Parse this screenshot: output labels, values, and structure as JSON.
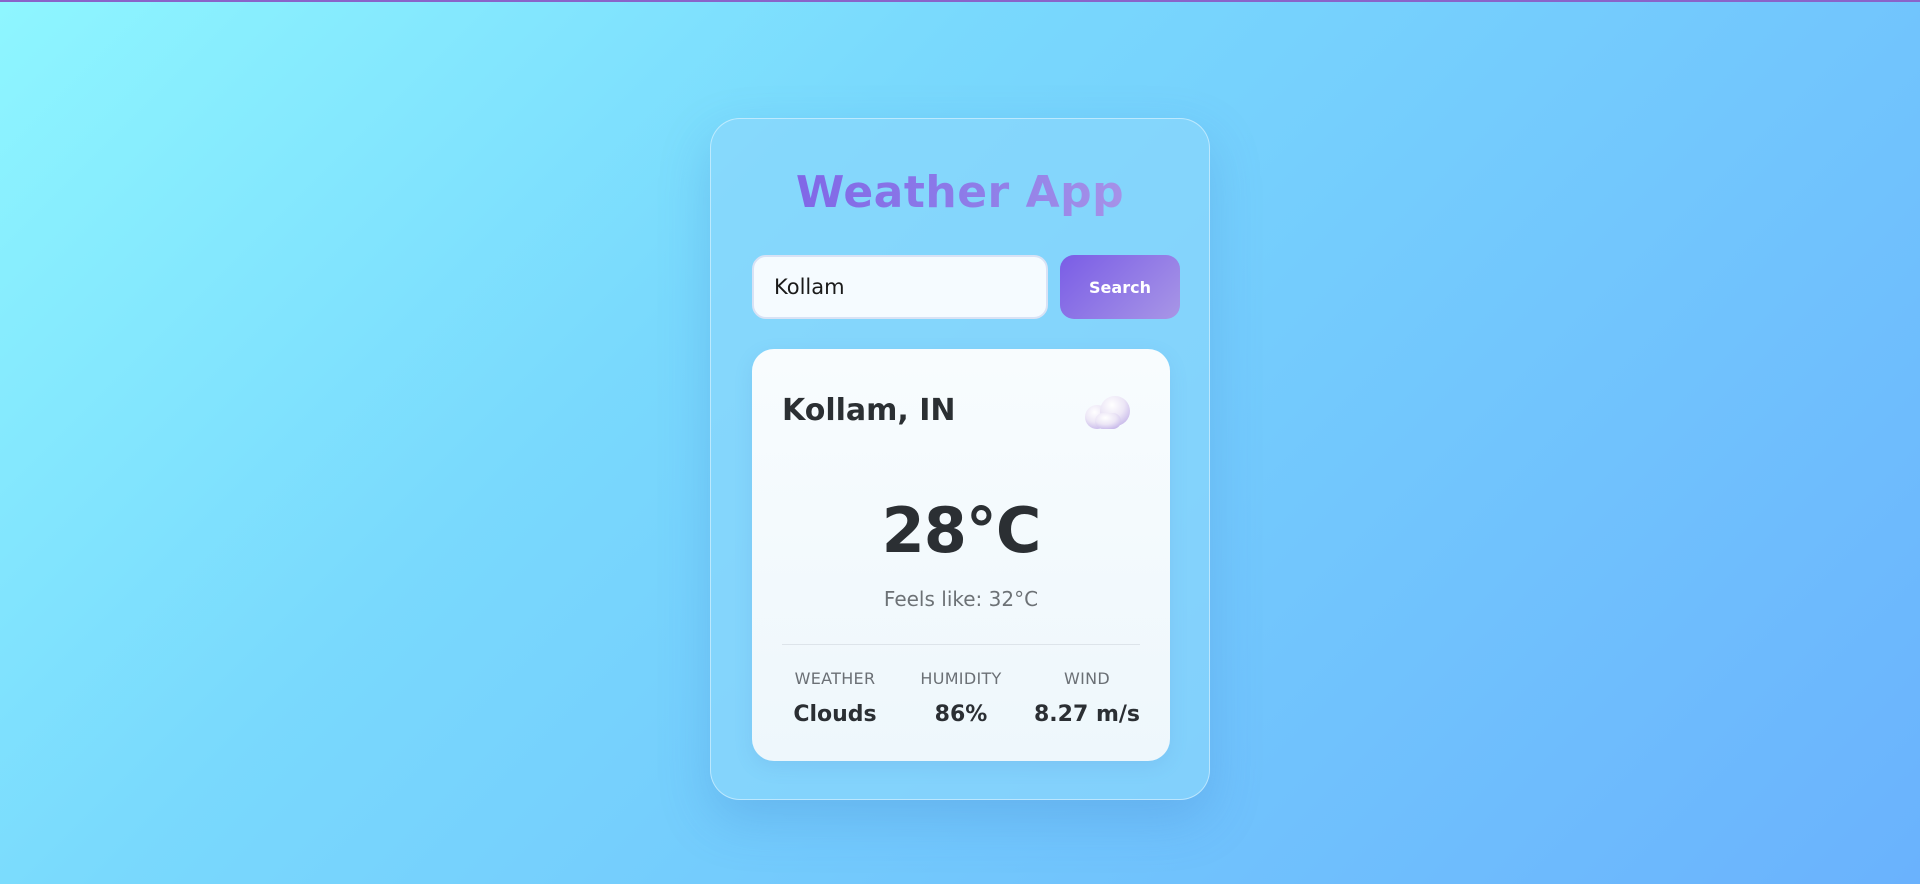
{
  "app": {
    "title": "Weather App"
  },
  "search": {
    "value": "Kollam",
    "button_label": "Search"
  },
  "weather": {
    "location": "Kollam, IN",
    "icon": "cloud-icon",
    "temperature": "28°C",
    "feels_like_label": "Feels like: ",
    "feels_like_value": "32°C",
    "details": [
      {
        "label": "WEATHER",
        "value": "Clouds"
      },
      {
        "label": "HUMIDITY",
        "value": "86%"
      },
      {
        "label": "WIND",
        "value": "8.27 m/s"
      }
    ]
  },
  "colors": {
    "accent_start": "#7a5de6",
    "accent_end": "#a896e6",
    "background_start": "#8ef6ff",
    "background_end": "#6ab2fd",
    "text_dark": "#2b2f33",
    "text_muted": "#6d7276"
  }
}
